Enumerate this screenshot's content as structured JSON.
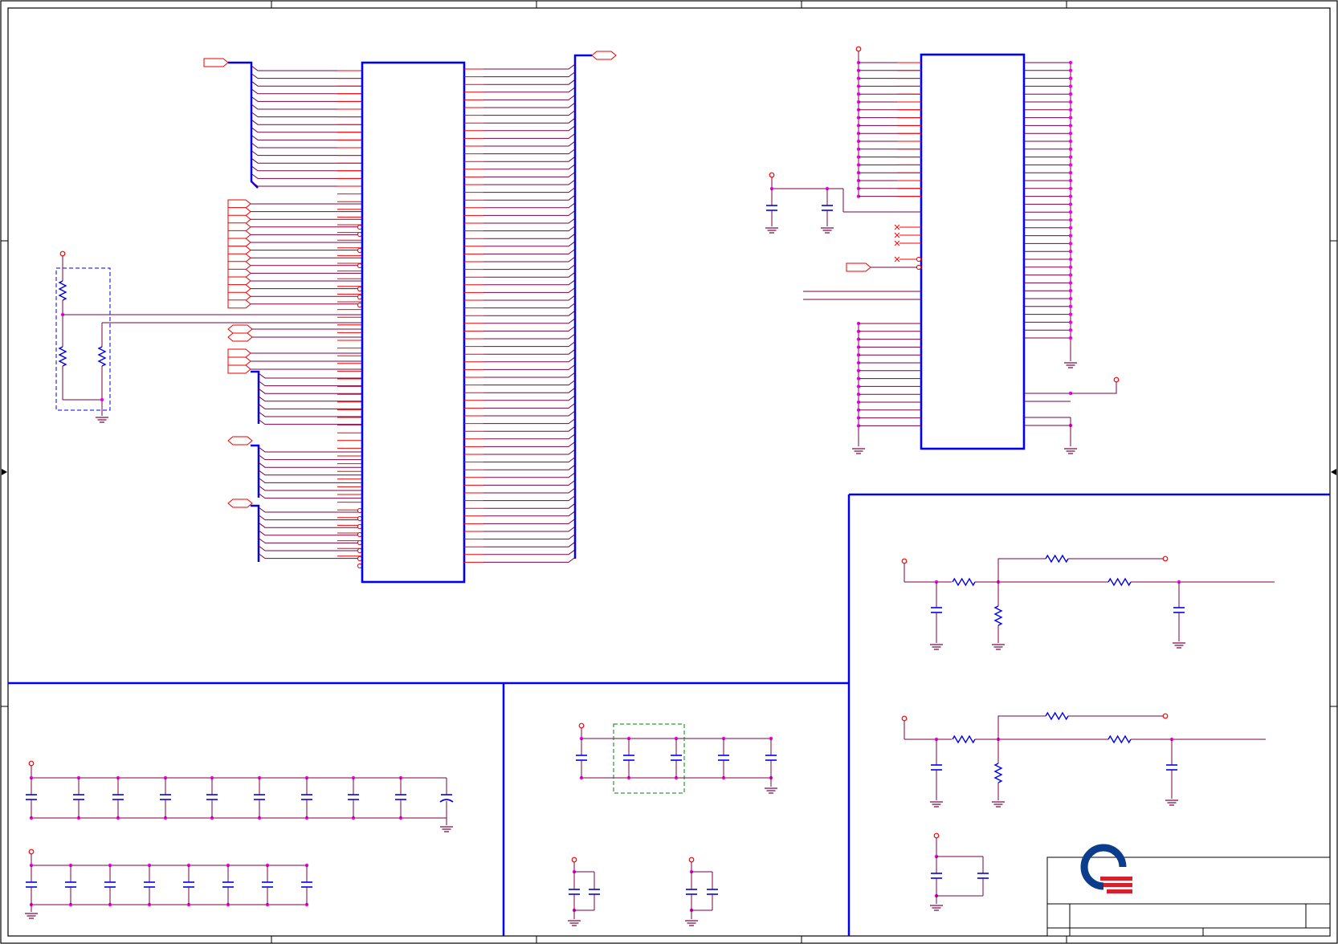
{
  "document": {
    "type": "schematic-sheet",
    "text_legible": false
  },
  "colors": {
    "bus_wire": "#0000ee",
    "net_wire": "#7a0040",
    "pin_stub": "#ff0000",
    "junction": "#ee00ee",
    "component_body": "#0000ee",
    "port_outline": "#ee0000",
    "optional_region": "#0000ee",
    "optional_region_alt": "#008000",
    "logo_blue": "#0c3d8c",
    "logo_red": "#d8202c",
    "frame": "#000000",
    "background": "#ffffff"
  },
  "icons": {
    "ground": "ground-symbol-icon",
    "power": "power-rail-icon",
    "capacitor": "capacitor-icon",
    "polarized_capacitor": "polarized-capacitor-icon",
    "resistor": "resistor-icon",
    "no_connect": "no-connect-x-icon",
    "offpage_port": "offpage-connector-icon",
    "logo": "company-logo-icon"
  },
  "title_block": {
    "logo": "company-logo-icon"
  }
}
